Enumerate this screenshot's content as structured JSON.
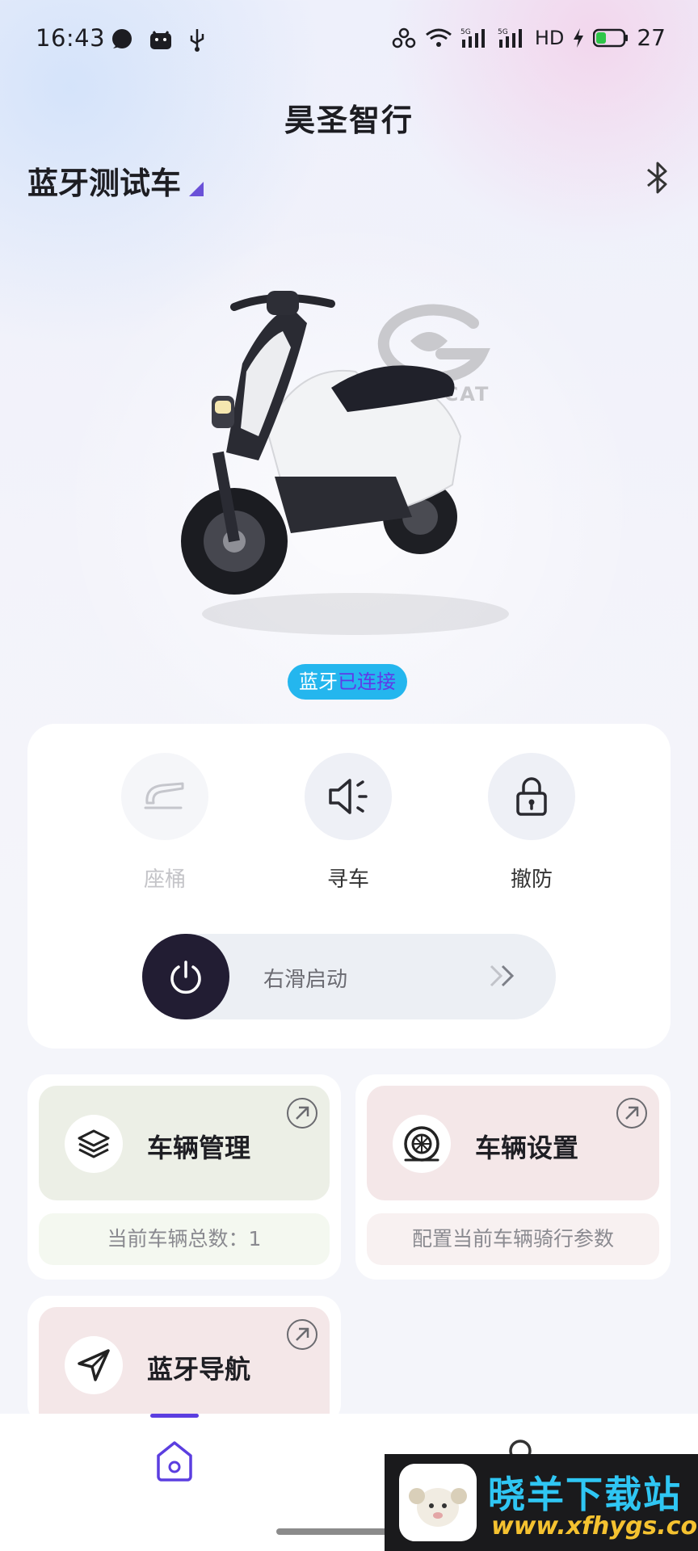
{
  "status_bar": {
    "time": "16:43",
    "network_label": "HD",
    "battery_level": "27",
    "icons": [
      "chat-bubble-icon",
      "android-icon",
      "usb-icon",
      "hotspot-icon",
      "wifi-icon",
      "signal-5g-icon",
      "signal-5g-icon",
      "hd-icon",
      "charging-icon",
      "battery-icon"
    ]
  },
  "header": {
    "app_title": "昊圣智行"
  },
  "vehicle": {
    "name": "蓝牙测试车",
    "bluetooth_icon": "bluetooth-icon",
    "brand_logo_text": "GOLD CAT"
  },
  "connection": {
    "prefix": "蓝牙",
    "status": "已连接",
    "badge_color": "#24b6ee",
    "status_color": "#5f3be7"
  },
  "controls": {
    "seat": {
      "label": "座桶",
      "icon": "seat-icon",
      "enabled": false
    },
    "find": {
      "label": "寻车",
      "icon": "speaker-icon",
      "enabled": true
    },
    "disarm": {
      "label": "撤防",
      "icon": "lock-icon",
      "enabled": true
    },
    "slider": {
      "label": "右滑启动",
      "icon": "power-icon"
    }
  },
  "features": {
    "vehicle_mgmt": {
      "title": "车辆管理",
      "subtitle": "当前车辆总数：1",
      "icon": "layers-icon",
      "bg": "#ecefe6"
    },
    "vehicle_settings": {
      "title": "车辆设置",
      "subtitle": "配置当前车辆骑行参数",
      "icon": "tire-icon",
      "bg": "#f4e7e8"
    },
    "bt_nav": {
      "title": "蓝牙导航",
      "icon": "navigation-icon",
      "bg": "#f4e7e8"
    }
  },
  "bottom_nav": {
    "items": [
      {
        "name": "home",
        "icon": "home-icon",
        "active": true
      },
      {
        "name": "profile",
        "icon": "profile-icon",
        "active": false
      }
    ],
    "accent": "#5b3ee0"
  },
  "watermark": {
    "title": "晓羊下载站",
    "url": "www.xfhygs.com"
  }
}
